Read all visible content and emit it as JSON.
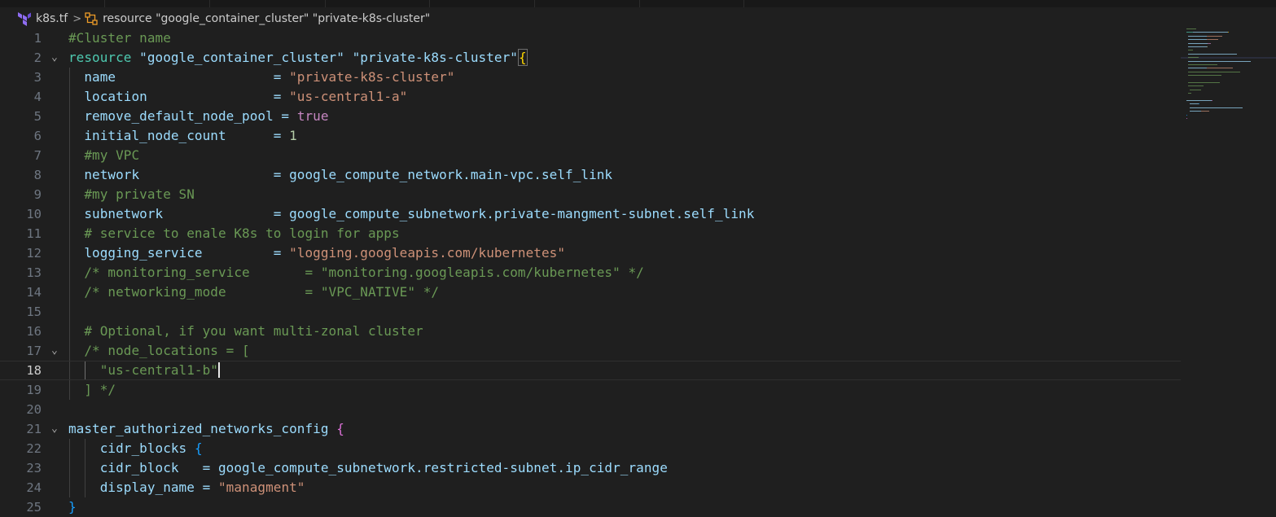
{
  "breadcrumb": {
    "file_icon": "terraform-icon",
    "file": "k8s.tf",
    "separator": ">",
    "symbol_icon": "symbol-structure-icon",
    "symbol": "resource \"google_container_cluster\" \"private-k8s-cluster\""
  },
  "editor": {
    "current_line": 18,
    "lines": [
      {
        "n": "1",
        "fold": "",
        "tokens": [
          {
            "t": "#Cluster name",
            "c": "cm"
          }
        ]
      },
      {
        "n": "2",
        "fold": "⌄",
        "tokens": [
          {
            "t": "resource ",
            "c": "kw"
          },
          {
            "t": "\"google_container_cluster\" \"private-k8s-cluster\"",
            "c": "prop"
          },
          {
            "t": "{",
            "c": "br1"
          }
        ]
      },
      {
        "n": "3",
        "fold": "",
        "tokens": [
          {
            "t": "  name                    = ",
            "c": "prop"
          },
          {
            "t": "\"private-k8s-cluster\"",
            "c": "str"
          }
        ]
      },
      {
        "n": "4",
        "fold": "",
        "tokens": [
          {
            "t": "  location                = ",
            "c": "prop"
          },
          {
            "t": "\"us-central1-a\"",
            "c": "str"
          }
        ]
      },
      {
        "n": "5",
        "fold": "",
        "tokens": [
          {
            "t": "  remove_default_node_pool = ",
            "c": "prop"
          },
          {
            "t": "true",
            "c": "bool"
          }
        ]
      },
      {
        "n": "6",
        "fold": "",
        "tokens": [
          {
            "t": "  initial_node_count      = ",
            "c": "prop"
          },
          {
            "t": "1",
            "c": "num"
          }
        ]
      },
      {
        "n": "7",
        "fold": "",
        "tokens": [
          {
            "t": "  #my VPC",
            "c": "cm"
          }
        ]
      },
      {
        "n": "8",
        "fold": "",
        "tokens": [
          {
            "t": "  network                 = google_compute_network.main-vpc.self_link",
            "c": "prop"
          }
        ]
      },
      {
        "n": "9",
        "fold": "",
        "tokens": [
          {
            "t": "  #my private SN",
            "c": "cm"
          }
        ]
      },
      {
        "n": "10",
        "fold": "",
        "tokens": [
          {
            "t": "  subnetwork              = google_compute_subnetwork.private-mangment-subnet.self_link",
            "c": "prop"
          }
        ]
      },
      {
        "n": "11",
        "fold": "",
        "tokens": [
          {
            "t": "  # service to enale K8s to login for apps",
            "c": "cm"
          }
        ]
      },
      {
        "n": "12",
        "fold": "",
        "tokens": [
          {
            "t": "  logging_service         = ",
            "c": "prop"
          },
          {
            "t": "\"logging.googleapis.com/kubernetes\"",
            "c": "str"
          }
        ]
      },
      {
        "n": "13",
        "fold": "",
        "tokens": [
          {
            "t": "  /* monitoring_service       = \"monitoring.googleapis.com/kubernetes\" */",
            "c": "cm"
          }
        ]
      },
      {
        "n": "14",
        "fold": "",
        "tokens": [
          {
            "t": "  /* networking_mode          = \"VPC_NATIVE\" */",
            "c": "cm"
          }
        ]
      },
      {
        "n": "15",
        "fold": "",
        "tokens": []
      },
      {
        "n": "16",
        "fold": "",
        "tokens": [
          {
            "t": "  # Optional, if you want multi-zonal cluster",
            "c": "cm"
          }
        ]
      },
      {
        "n": "17",
        "fold": "⌄",
        "tokens": [
          {
            "t": "  /* node_locations = [",
            "c": "cm"
          }
        ]
      },
      {
        "n": "18",
        "fold": "",
        "tokens": [
          {
            "t": "    \"us-central1-b\"",
            "c": "cm"
          }
        ]
      },
      {
        "n": "19",
        "fold": "",
        "tokens": [
          {
            "t": "  ] */",
            "c": "cm"
          }
        ]
      },
      {
        "n": "20",
        "fold": "",
        "tokens": []
      },
      {
        "n": "21",
        "fold": "⌄",
        "tokens": [
          {
            "t": "master_authorized_networks_config ",
            "c": "prop"
          },
          {
            "t": "{",
            "c": "br2"
          }
        ]
      },
      {
        "n": "22",
        "fold": "",
        "tokens": [
          {
            "t": "    cidr_blocks ",
            "c": "prop"
          },
          {
            "t": "{",
            "c": "br3"
          }
        ]
      },
      {
        "n": "23",
        "fold": "",
        "tokens": [
          {
            "t": "    cidr_block   = google_compute_subnetwork.restricted-subnet.ip_cidr_range",
            "c": "prop"
          }
        ]
      },
      {
        "n": "24",
        "fold": "",
        "tokens": [
          {
            "t": "    display_name = ",
            "c": "prop"
          },
          {
            "t": "\"managment\"",
            "c": "str"
          }
        ]
      },
      {
        "n": "25",
        "fold": "",
        "tokens": [
          {
            "t": "}",
            "c": "br3"
          }
        ]
      },
      {
        "n": "",
        "fold": "",
        "tokens": [
          {
            "t": "}",
            "c": "br2"
          }
        ]
      }
    ]
  },
  "colors": {
    "background": "#1f1f1f",
    "comment": "#6a9955",
    "keyword": "#4ec9b0",
    "string": "#ce9178",
    "property": "#9cdcfe",
    "boolean": "#c586c0",
    "number": "#b5cea8",
    "bracket_level1": "#ffd700",
    "bracket_level2": "#da70d6",
    "bracket_level3": "#179fff"
  }
}
